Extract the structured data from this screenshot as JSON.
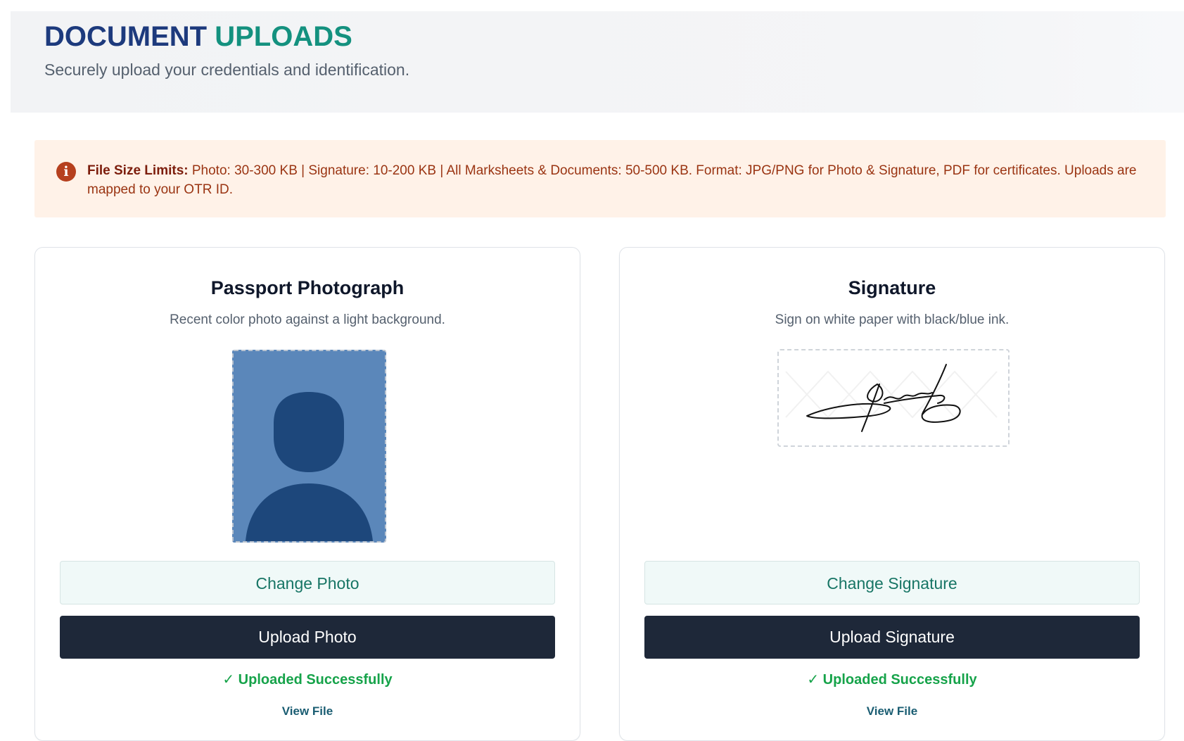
{
  "header": {
    "title_part1": "DOCUMENT",
    "title_part2": "UPLOADS",
    "subtitle": "Securely upload your credentials and identification."
  },
  "notice": {
    "icon": "info-icon",
    "label": "File Size Limits:",
    "text": "Photo: 30-300 KB | Signature: 10-200 KB | All Marksheets & Documents: 50-500 KB. Format: JPG/PNG for Photo & Signature, PDF for certificates. Uploads are mapped to your OTR ID."
  },
  "cards": [
    {
      "title": "Passport Photograph",
      "description": "Recent color photo against a light background.",
      "change_label": "Change Photo",
      "upload_label": "Upload Photo",
      "status": "✓ Uploaded Successfully",
      "view_label": "View File"
    },
    {
      "title": "Signature",
      "description": "Sign on white paper with black/blue ink.",
      "change_label": "Change Signature",
      "upload_label": "Upload Signature",
      "status": "✓ Uploaded Successfully",
      "view_label": "View File"
    }
  ],
  "colors": {
    "title_navy": "#1d3a7d",
    "title_teal": "#14917f",
    "notice_bg": "#fff2e8",
    "notice_text": "#9a3412",
    "upload_button": "#1e2839",
    "change_button_text": "#177565",
    "success_green": "#16a34a",
    "photo_bg": "#5b87ba",
    "photo_silhouette": "#1d477b"
  }
}
